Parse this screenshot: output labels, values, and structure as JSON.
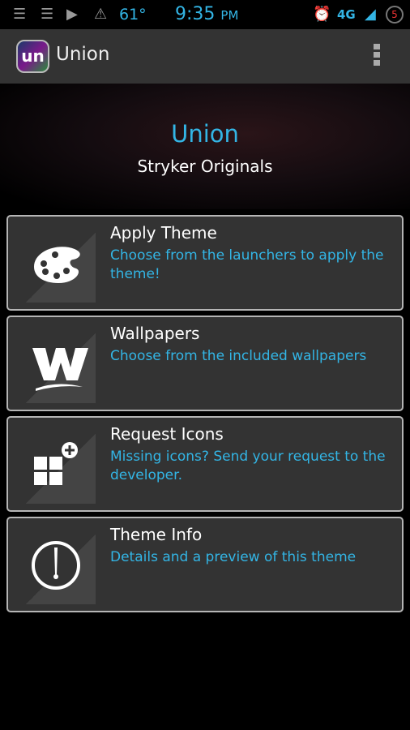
{
  "status_bar": {
    "temperature": "61°",
    "time": "9:35",
    "ampm": "PM",
    "network": "4G",
    "notification_count": "5",
    "icons": [
      "storage-icon",
      "storage-icon",
      "youtube-icon",
      "warning-icon",
      "alarm-icon",
      "network-4g-icon",
      "signal-icon",
      "notification-count-icon"
    ]
  },
  "action_bar": {
    "logo_text": "un",
    "title": "Union",
    "menu_icon": "overflow-menu-icon"
  },
  "header": {
    "title": "Union",
    "subtitle": "Stryker Originals"
  },
  "accent_color": "#33b5e5",
  "cards": [
    {
      "title": "Apply Theme",
      "description": "Choose from the launchers to apply the theme!",
      "icon": "palette-icon"
    },
    {
      "title": "Wallpapers",
      "description": "Choose from the included wallpapers",
      "icon": "wallpaper-w-icon"
    },
    {
      "title": "Request Icons",
      "description": "Missing icons? Send your request to the developer.",
      "icon": "request-icons-icon"
    },
    {
      "title": "Theme Info",
      "description": "Details and a preview of this theme",
      "icon": "clock-info-icon"
    }
  ]
}
